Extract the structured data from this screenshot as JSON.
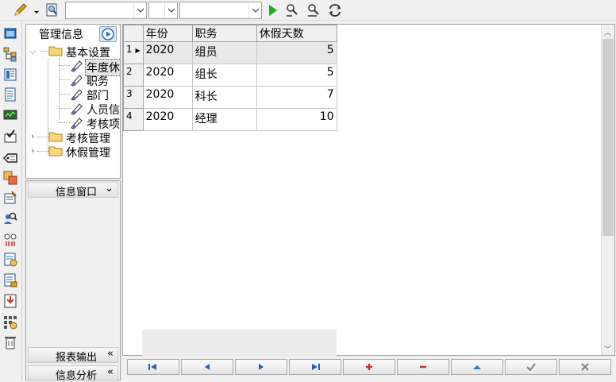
{
  "toolbar": {
    "combo1": {
      "value": ""
    },
    "combo2": {
      "value": ""
    },
    "combo3": {
      "value": ""
    }
  },
  "tree": {
    "title": "管理信息",
    "nodes": [
      {
        "label": "基本设置"
      },
      {
        "label": "年度休"
      },
      {
        "label": "职务"
      },
      {
        "label": "部门"
      },
      {
        "label": "人员信"
      },
      {
        "label": "考核项"
      },
      {
        "label": "考核管理"
      },
      {
        "label": "休假管理"
      }
    ]
  },
  "panels": {
    "info_window": "信息窗口",
    "report_output": "报表输出",
    "info_analysis": "信息分析"
  },
  "grid": {
    "columns": [
      "年份",
      "职务",
      "休假天数"
    ],
    "rows": [
      {
        "n": "1",
        "year": "2020",
        "position": "组员",
        "days": "5"
      },
      {
        "n": "2",
        "year": "2020",
        "position": "组长",
        "days": "5"
      },
      {
        "n": "3",
        "year": "2020",
        "position": "科长",
        "days": "7"
      },
      {
        "n": "4",
        "year": "2020",
        "position": "经理",
        "days": "10"
      }
    ]
  },
  "colors": {
    "accent": "#1f6fd1",
    "run_green": "#18b018",
    "add_red": "#d03020"
  }
}
